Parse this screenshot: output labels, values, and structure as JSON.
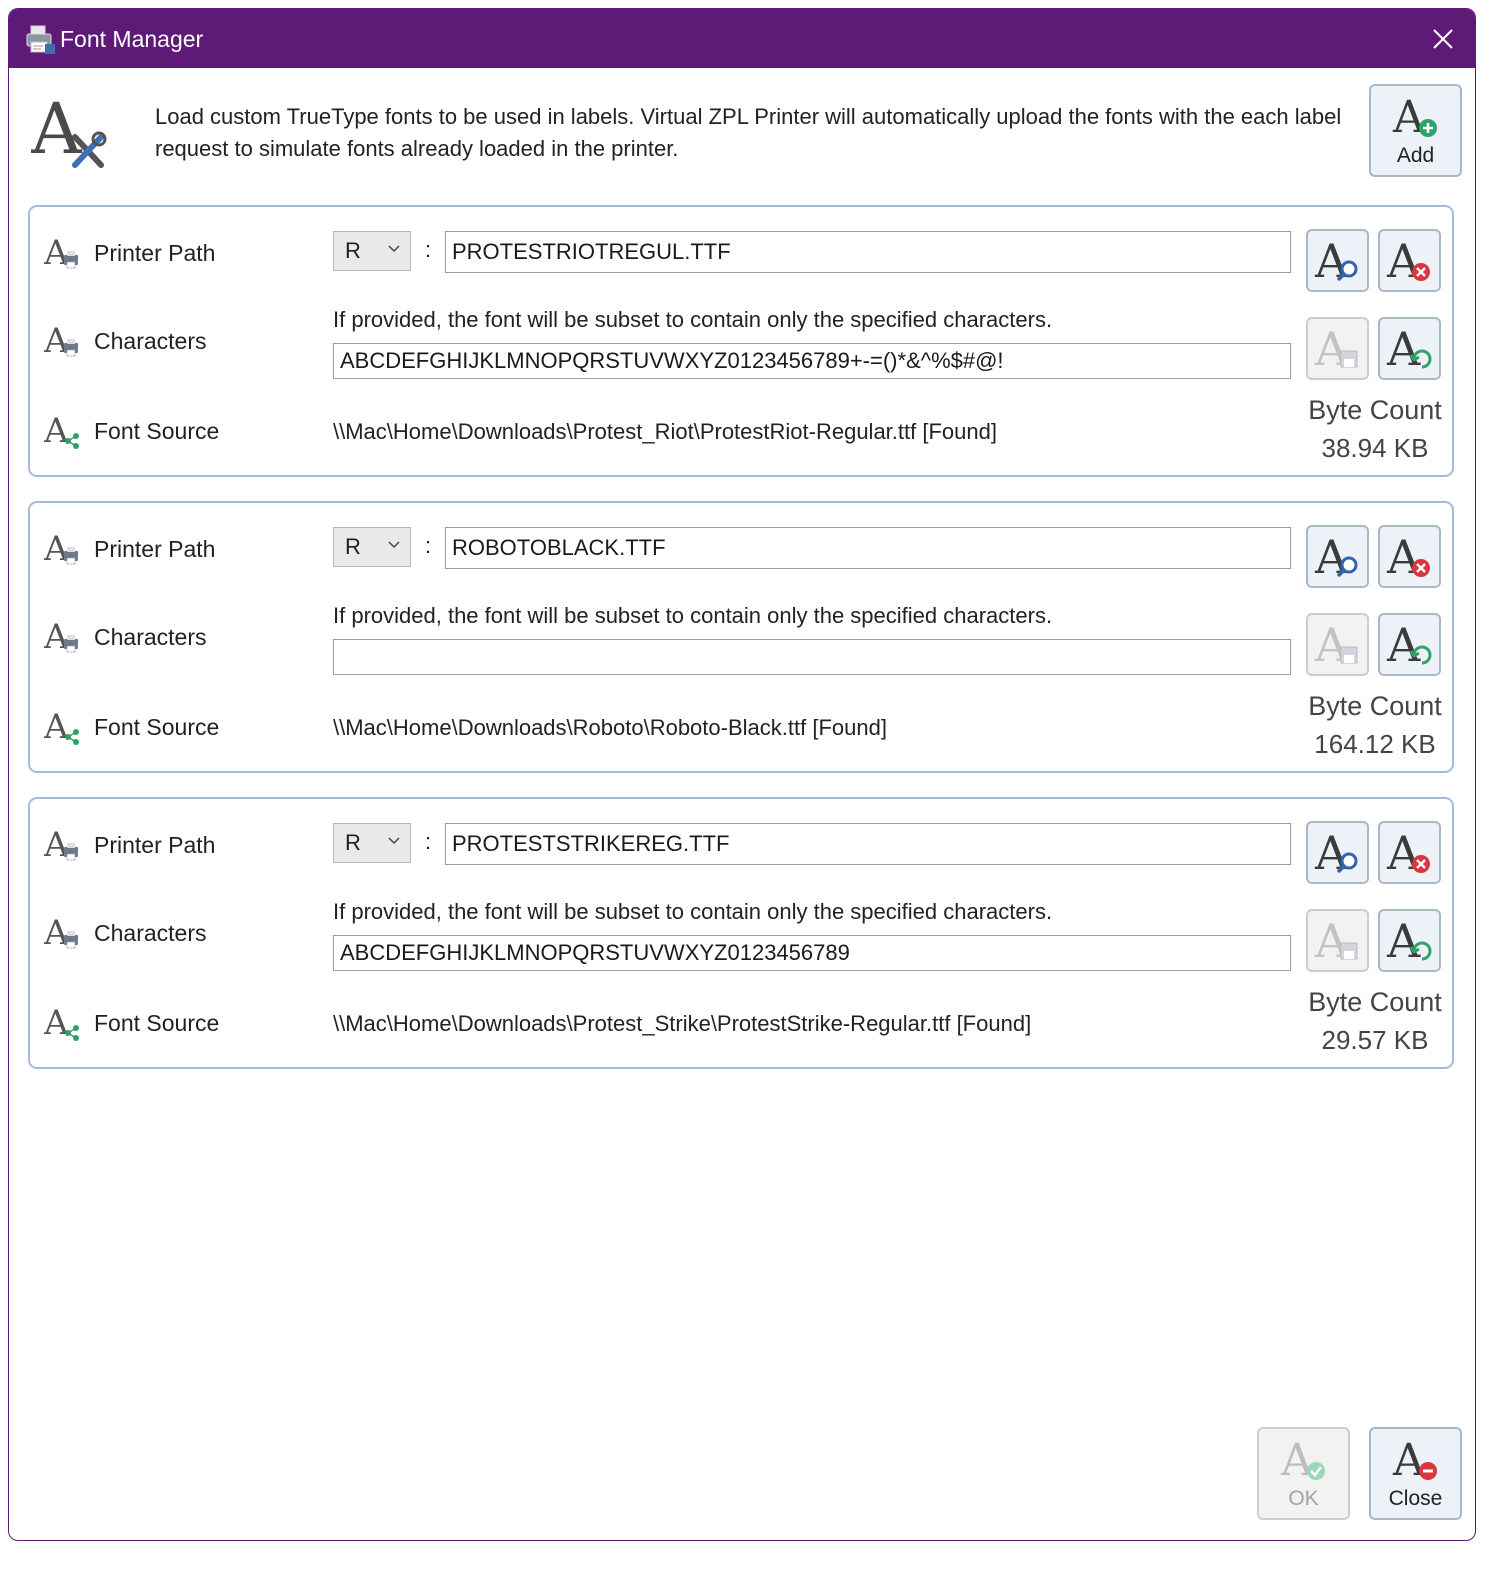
{
  "window": {
    "title": "Font Manager"
  },
  "header": {
    "description": "Load custom TrueType fonts to be used in labels. Virtual ZPL Printer will automatically upload the fonts with the each label request to simulate fonts already loaded in the printer.",
    "add_label": "Add"
  },
  "labels": {
    "printer_path": "Printer Path",
    "characters": "Characters",
    "font_source": "Font Source",
    "hint": "If provided, the font will be subset to contain only the specified characters.",
    "byte_count": "Byte Count",
    "separator": ":"
  },
  "fonts": [
    {
      "drive": "R",
      "printer_path": "PROTESTRIOTREGUL.TTF",
      "characters": "ABCDEFGHIJKLMNOPQRSTUVWXYZ0123456789+-=()*&^%$#@!",
      "font_source": "\\\\Mac\\Home\\Downloads\\Protest_Riot\\ProtestRiot-Regular.ttf [Found]",
      "byte_count": "38.94 KB"
    },
    {
      "drive": "R",
      "printer_path": "ROBOTOBLACK.TTF",
      "characters": "",
      "font_source": "\\\\Mac\\Home\\Downloads\\Roboto\\Roboto-Black.ttf [Found]",
      "byte_count": "164.12 KB"
    },
    {
      "drive": "R",
      "printer_path": "PROTESTSTRIKEREG.TTF",
      "characters": "ABCDEFGHIJKLMNOPQRSTUVWXYZ0123456789",
      "font_source": "\\\\Mac\\Home\\Downloads\\Protest_Strike\\ProtestStrike-Regular.ttf [Found]",
      "byte_count": "29.57 KB"
    }
  ],
  "footer": {
    "ok_label": "OK",
    "close_label": "Close"
  },
  "colors": {
    "titlebar": "#5f1a78",
    "card_border": "#a7bbd8",
    "button_border": "#a9b8c6"
  },
  "icons": {
    "title": "printer-app-icon",
    "header": "font-tools-icon",
    "add": "font-add-icon",
    "row_printer": "font-printer-icon",
    "row_source": "font-share-icon",
    "find": "font-search-icon",
    "delete": "font-delete-icon",
    "save": "font-save-icon",
    "refresh": "font-refresh-icon",
    "ok": "font-check-icon",
    "close": "font-remove-icon"
  }
}
